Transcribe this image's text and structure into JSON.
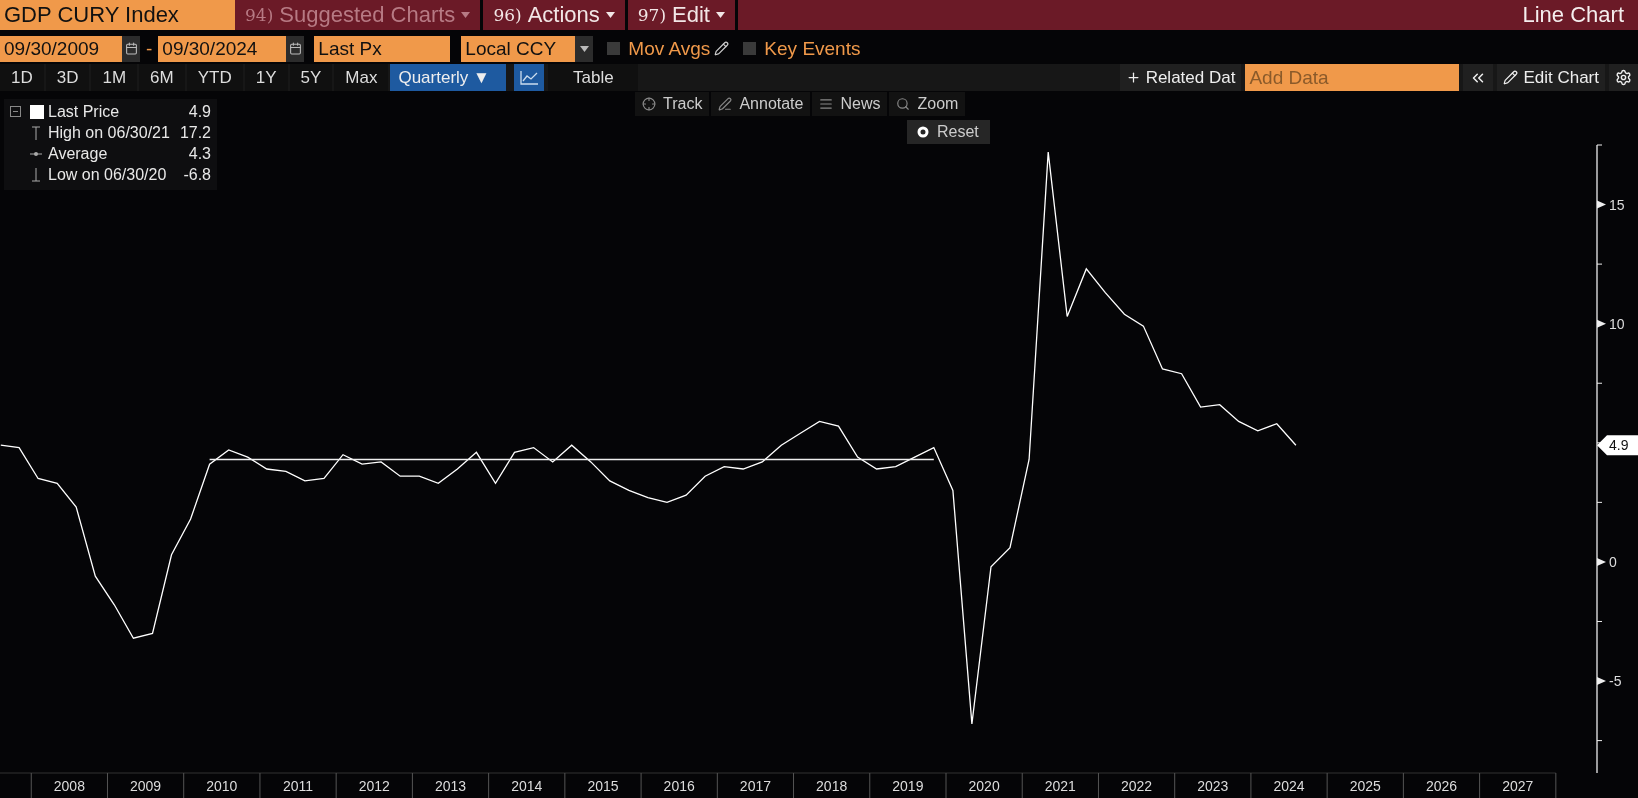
{
  "header": {
    "security": "GDP CURY Index",
    "menus": [
      {
        "number": "94)",
        "label": "Suggested Charts",
        "disabled": true
      },
      {
        "number": "96)",
        "label": "Actions",
        "disabled": false
      },
      {
        "number": "97)",
        "label": "Edit",
        "disabled": false
      }
    ],
    "title": "Line Chart"
  },
  "controls": {
    "start_date": "09/30/2009",
    "separator": "-",
    "end_date": "09/30/2024",
    "field": "Last Px",
    "currency": "Local CCY",
    "toggles": [
      {
        "kind": "editable",
        "label": "Mov Avgs",
        "checked": false
      },
      {
        "kind": "plain",
        "label": "Key Events",
        "checked": false
      }
    ]
  },
  "periods": [
    {
      "label": "1D",
      "selected": false
    },
    {
      "label": "3D",
      "selected": false
    },
    {
      "label": "1M",
      "selected": false
    },
    {
      "label": "6M",
      "selected": false
    },
    {
      "label": "YTD",
      "selected": false
    },
    {
      "label": "1Y",
      "selected": false
    },
    {
      "label": "5Y",
      "selected": false
    },
    {
      "label": "Max",
      "selected": false
    }
  ],
  "periodicity": "Quarterly ▼",
  "views": [
    {
      "kind": "chart",
      "selected": true
    },
    {
      "kind": "table",
      "label": "Table",
      "selected": false
    }
  ],
  "actions": {
    "related": "Related Dat",
    "add_data_placeholder": "Add Data",
    "edit_chart": "Edit Chart"
  },
  "chart_tools": [
    {
      "kind": "track",
      "label": "Track"
    },
    {
      "kind": "annotate",
      "label": "Annotate"
    },
    {
      "kind": "news",
      "label": "News"
    },
    {
      "kind": "zoom",
      "label": "Zoom"
    }
  ],
  "reset": "Reset",
  "legend": [
    {
      "kind": "last",
      "value": "4.9"
    },
    {
      "kind": "high",
      "label": "High on 06/30/21",
      "value": "17.2"
    },
    {
      "kind": "average",
      "value": "4.3"
    },
    {
      "kind": "low",
      "label": "Low on 06/30/20",
      "value": "-6.8"
    }
  ],
  "price_tag": "4.9",
  "chart_data": {
    "type": "line",
    "xlim": [
      2007.59,
      2028.54
    ],
    "ylim": [
      -8.86,
      17.5
    ],
    "yticks": [
      -5,
      0,
      10,
      15
    ],
    "xticks": [
      {
        "value": 2008.5,
        "label": "2008"
      },
      {
        "value": 2009.5,
        "label": "2009"
      },
      {
        "value": 2010.5,
        "label": "2010"
      },
      {
        "value": 2011.5,
        "label": "2011"
      },
      {
        "value": 2012.5,
        "label": "2012"
      },
      {
        "value": 2013.5,
        "label": "2013"
      },
      {
        "value": 2014.5,
        "label": "2014"
      },
      {
        "value": 2015.5,
        "label": "2015"
      },
      {
        "value": 2016.5,
        "label": "2016"
      },
      {
        "value": 2017.5,
        "label": "2017"
      },
      {
        "value": 2018.5,
        "label": "2018"
      },
      {
        "value": 2019.5,
        "label": "2019"
      },
      {
        "value": 2020.5,
        "label": "2020"
      },
      {
        "value": 2021.5,
        "label": "2021"
      },
      {
        "value": 2022.5,
        "label": "2022"
      },
      {
        "value": 2023.5,
        "label": "2023"
      },
      {
        "value": 2024.5,
        "label": "2024"
      },
      {
        "value": 2025.5,
        "label": "2025"
      },
      {
        "value": 2026.5,
        "label": "2026"
      },
      {
        "value": 2027.5,
        "label": "2027"
      }
    ],
    "x": [
      2007.6,
      2007.84,
      2008.09,
      2008.34,
      2008.59,
      2008.84,
      2009.09,
      2009.34,
      2009.59,
      2009.84,
      2010.09,
      2010.34,
      2010.59,
      2010.84,
      2011.09,
      2011.34,
      2011.59,
      2011.84,
      2012.09,
      2012.34,
      2012.59,
      2012.84,
      2013.09,
      2013.34,
      2013.59,
      2013.84,
      2014.09,
      2014.34,
      2014.59,
      2014.84,
      2015.09,
      2015.34,
      2015.59,
      2015.84,
      2016.09,
      2016.34,
      2016.59,
      2016.84,
      2017.09,
      2017.34,
      2017.59,
      2017.84,
      2018.09,
      2018.34,
      2018.59,
      2018.84,
      2019.09,
      2019.34,
      2019.59,
      2019.84,
      2020.09,
      2020.34,
      2020.59,
      2020.84,
      2021.09,
      2021.34,
      2021.59,
      2021.84,
      2022.09,
      2022.34,
      2022.59,
      2022.84,
      2023.09,
      2023.34,
      2023.59,
      2023.84,
      2024.09,
      2024.34,
      2024.59
    ],
    "series": [
      {
        "name": "Last Price",
        "color": "#ffffff",
        "values": [
          4.9,
          4.8,
          3.5,
          3.3,
          2.3,
          -0.6,
          -1.8,
          -3.2,
          -3.0,
          0.3,
          1.8,
          4.1,
          4.7,
          4.4,
          3.9,
          3.8,
          3.4,
          3.5,
          4.5,
          4.1,
          4.2,
          3.6,
          3.6,
          3.3,
          3.9,
          4.6,
          3.3,
          4.6,
          4.8,
          4.2,
          4.9,
          4.2,
          3.4,
          3.0,
          2.7,
          2.5,
          2.8,
          3.6,
          4.0,
          3.9,
          4.2,
          4.9,
          5.4,
          5.9,
          5.7,
          4.4,
          3.9,
          4.0,
          4.4,
          4.8,
          3.0,
          -6.8,
          -0.2,
          0.6,
          4.3,
          17.2,
          10.3,
          12.3,
          11.3,
          10.4,
          9.9,
          8.1,
          7.9,
          6.5,
          6.6,
          5.9,
          5.5,
          5.8,
          4.9
        ]
      },
      {
        "name": "Average",
        "color": "#eeeeee",
        "values": [
          null,
          null,
          null,
          null,
          null,
          null,
          null,
          null,
          null,
          null,
          null,
          4.3,
          4.3,
          4.3,
          4.3,
          4.3,
          4.3,
          4.3,
          4.3,
          4.3,
          4.3,
          4.3,
          4.3,
          4.3,
          4.3,
          4.3,
          4.3,
          4.3,
          4.3,
          4.3,
          4.3,
          4.3,
          4.3,
          4.3,
          4.3,
          4.3,
          4.3,
          4.3,
          4.3,
          4.3,
          4.3,
          4.3,
          4.3,
          4.3,
          4.3,
          4.3,
          4.3,
          4.3,
          4.3,
          4.3,
          null,
          null,
          null,
          null,
          null,
          null,
          null,
          null,
          null,
          null,
          null,
          null,
          null,
          null,
          null,
          null,
          null,
          null,
          null
        ]
      }
    ]
  }
}
